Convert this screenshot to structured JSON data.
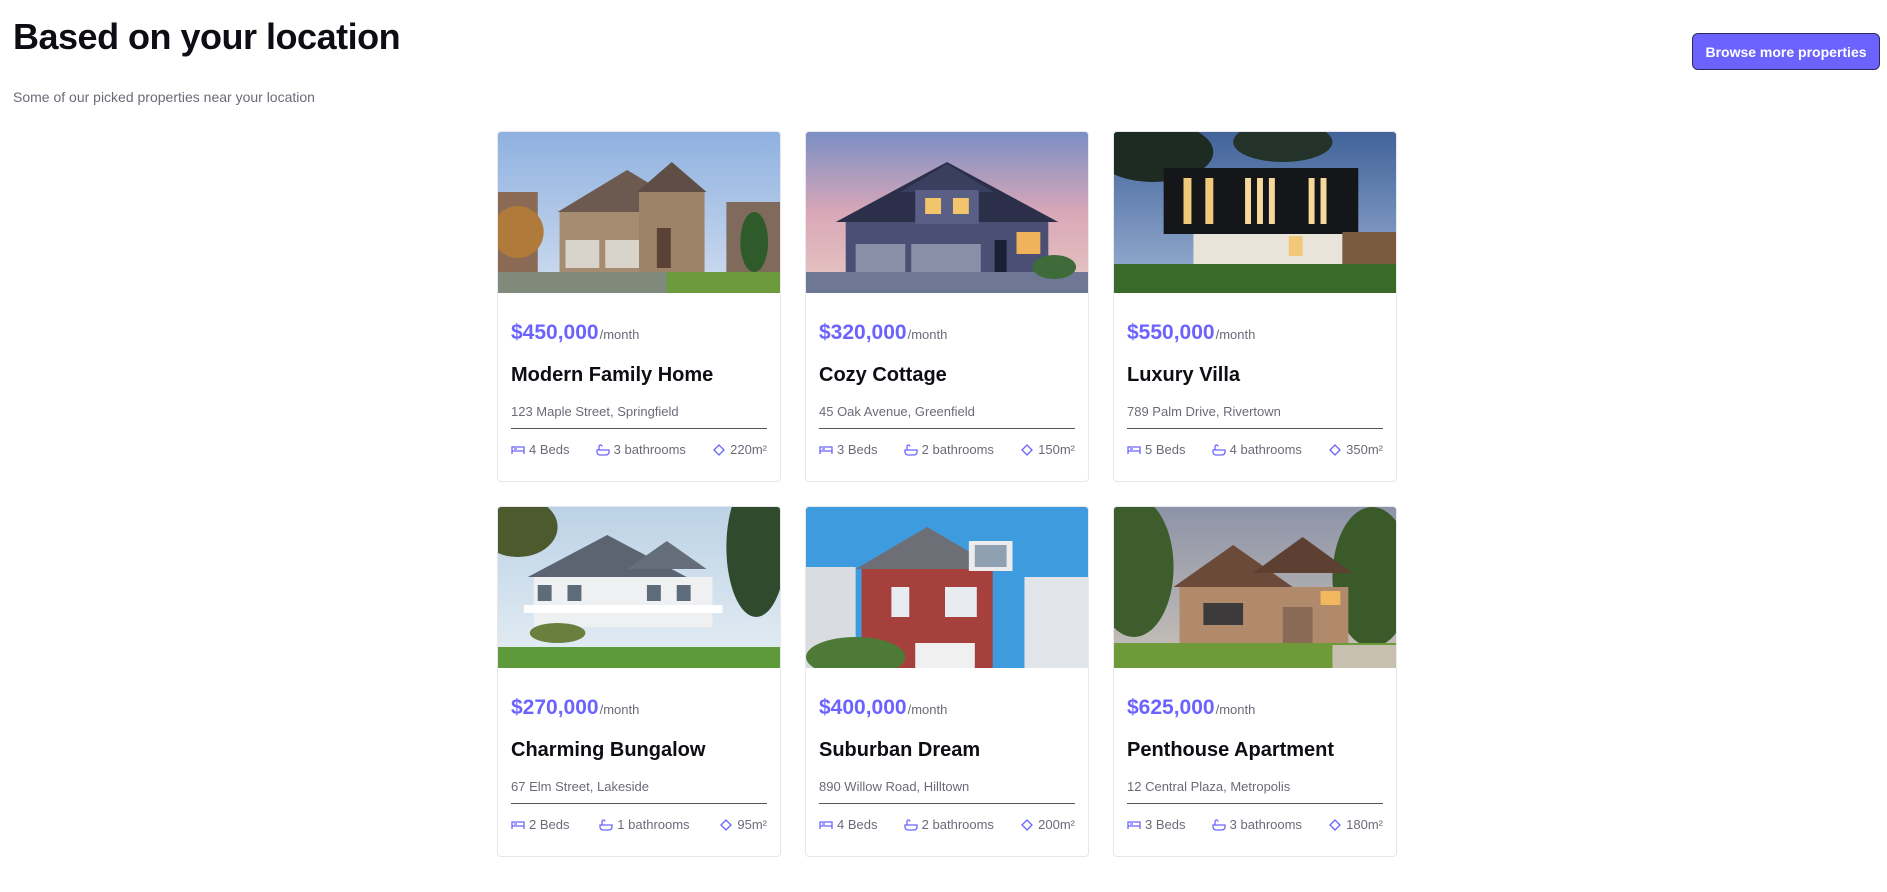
{
  "header": {
    "title": "Based on your location",
    "subtitle": "Some of our picked properties near your location",
    "browse_label": "Browse more properties"
  },
  "colors": {
    "accent": "#6c63ff",
    "muted": "#6b6b78",
    "heading": "#0d0d14"
  },
  "icons": {
    "beds": "bed-icon",
    "baths": "bathtub-icon",
    "area": "area-icon"
  },
  "properties": [
    {
      "price": "$450,000",
      "period": "/month",
      "name": "Modern Family Home",
      "address": "123 Maple Street, Springfield",
      "beds": "4 Beds",
      "baths": "3 bathrooms",
      "area": "220m²"
    },
    {
      "price": "$320,000",
      "period": "/month",
      "name": "Cozy Cottage",
      "address": "45 Oak Avenue, Greenfield",
      "beds": "3 Beds",
      "baths": "2 bathrooms",
      "area": "150m²"
    },
    {
      "price": "$550,000",
      "period": "/month",
      "name": "Luxury Villa",
      "address": "789 Palm Drive, Rivertown",
      "beds": "5 Beds",
      "baths": "4 bathrooms",
      "area": "350m²"
    },
    {
      "price": "$270,000",
      "period": "/month",
      "name": "Charming Bungalow",
      "address": "67 Elm Street, Lakeside",
      "beds": "2 Beds",
      "baths": "1 bathrooms",
      "area": "95m²"
    },
    {
      "price": "$400,000",
      "period": "/month",
      "name": "Suburban Dream",
      "address": "890 Willow Road, Hilltown",
      "beds": "4 Beds",
      "baths": "2 bathrooms",
      "area": "200m²"
    },
    {
      "price": "$625,000",
      "period": "/month",
      "name": "Penthouse Apartment",
      "address": "12 Central Plaza, Metropolis",
      "beds": "3 Beds",
      "baths": "3 bathrooms",
      "area": "180m²"
    }
  ]
}
